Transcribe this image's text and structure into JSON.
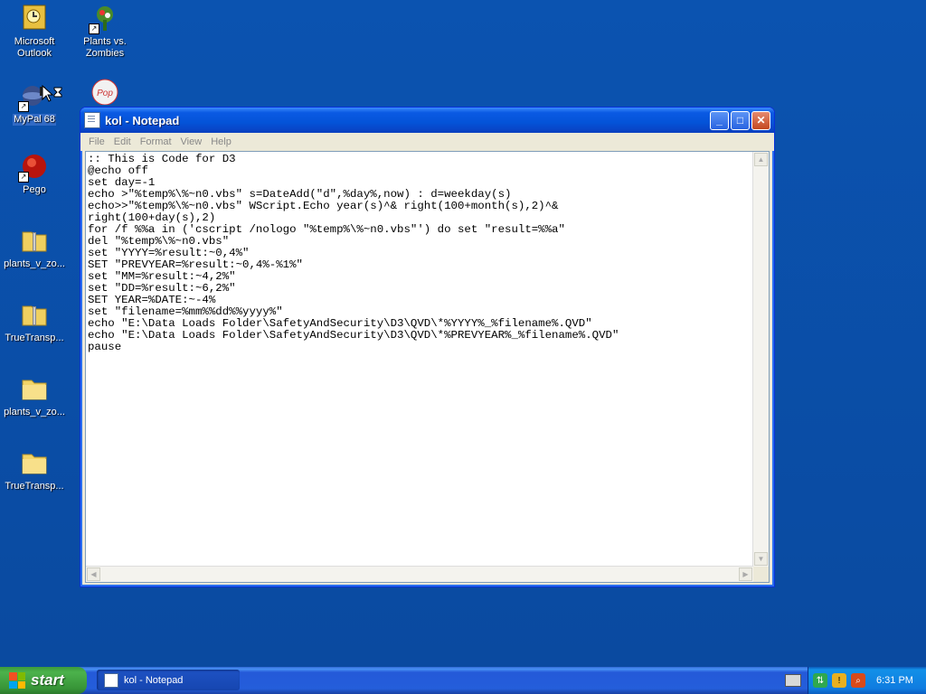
{
  "desktop": {
    "icons": [
      {
        "label": "Microsoft Outlook"
      },
      {
        "label": "Plants vs. Zombies"
      },
      {
        "label": "MyPal 68"
      },
      {
        "label": "Pego"
      },
      {
        "label": "plants_v_zo..."
      },
      {
        "label": "TrueTransp..."
      },
      {
        "label": "plants_v_zo..."
      },
      {
        "label": "TrueTransp..."
      }
    ]
  },
  "window": {
    "title": "kol - Notepad",
    "menu": [
      "File",
      "Edit",
      "Format",
      "View",
      "Help"
    ],
    "content": ":: This is Code for D3\n@echo off\nset day=-1\necho >\"%temp%\\%~n0.vbs\" s=DateAdd(\"d\",%day%,now) : d=weekday(s)\necho>>\"%temp%\\%~n0.vbs\" WScript.Echo year(s)^& right(100+month(s),2)^&\nright(100+day(s),2)\nfor /f %%a in ('cscript /nologo \"%temp%\\%~n0.vbs\"') do set \"result=%%a\"\ndel \"%temp%\\%~n0.vbs\"\nset \"YYYY=%result:~0,4%\"\nSET \"PREVYEAR=%result:~0,4%-%1%\"\nset \"MM=%result:~4,2%\"\nset \"DD=%result:~6,2%\"\nSET YEAR=%DATE:~-4%\nset \"filename=%mm%%dd%%yyyy%\"\necho \"E:\\Data Loads Folder\\SafetyAndSecurity\\D3\\QVD\\*%YYYY%_%filename%.QVD\"\necho \"E:\\Data Loads Folder\\SafetyAndSecurity\\D3\\QVD\\*%PREVYEAR%_%filename%.QVD\"\npause"
  },
  "taskbar": {
    "start_label": "start",
    "task_label": "kol - Notepad",
    "clock": "6:31 PM"
  },
  "icons": {
    "minimize": "minimize-icon",
    "maximize": "maximize-icon",
    "close": "close-icon"
  }
}
